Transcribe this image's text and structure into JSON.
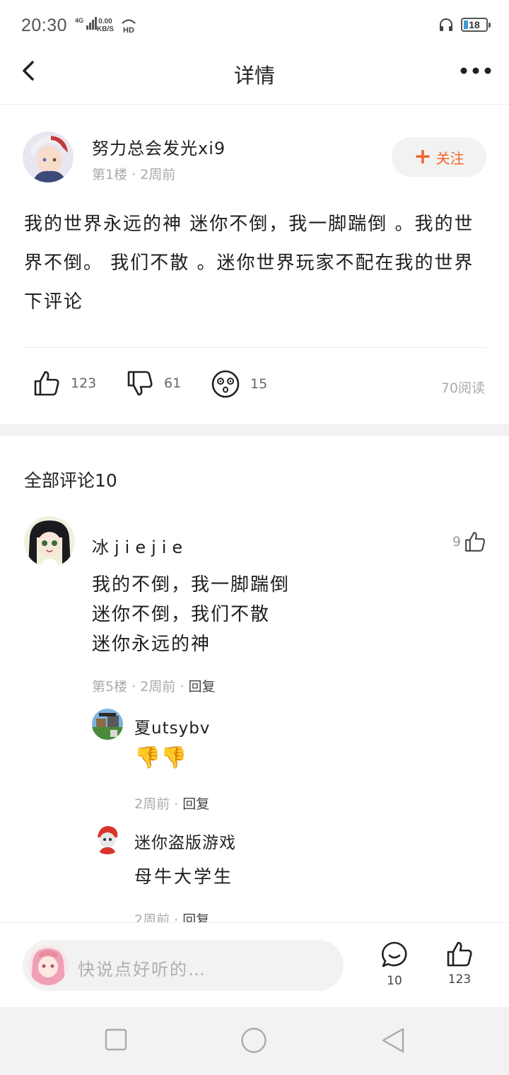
{
  "status_bar": {
    "time": "20:30",
    "network": "4G",
    "speed_value": "0.00",
    "speed_unit": "KB/S",
    "hd": "HD",
    "battery": "18",
    "icons": [
      "signal-icon",
      "headphone-icon",
      "battery-icon"
    ]
  },
  "nav": {
    "title": "详情",
    "back_icon": "chevron-left-icon",
    "more_icon": "more-dots-icon"
  },
  "post": {
    "username": "努力总会发光xi9",
    "floor": "第1楼",
    "time": "2周前",
    "follow_label": "关注",
    "body": "我的世界永远的神 迷你不倒，我一脚踹倒 。我的世界不倒。 我们不散 。迷你世界玩家不配在我的世界下评论",
    "likes": "123",
    "dislikes": "61",
    "surprised": "15",
    "views": "70阅读"
  },
  "comments": {
    "title": "全部评论10",
    "items": [
      {
        "username": "冰jiejie",
        "likes": "9",
        "lines": [
          "我的不倒，我一脚踹倒",
          "迷你不倒，我们不散",
          "迷你永远的神"
        ],
        "floor": "第5楼",
        "time": "2周前",
        "reply_label": "回复",
        "replies": [
          {
            "username": "夏utsybv",
            "emoji": "👎👎",
            "time": "2周前",
            "reply_label": "回复"
          },
          {
            "username": "迷你盗版游戏",
            "text": "母牛大学生",
            "time": "2周前",
            "reply_label": "回复"
          }
        ]
      }
    ]
  },
  "bottom_bar": {
    "placeholder": "快说点好听的…",
    "comment_count": "10",
    "like_count": "123"
  },
  "colors": {
    "accent": "#f0652c",
    "meta_text": "#aaaaaa",
    "gap_bg": "#f2f2f2"
  }
}
